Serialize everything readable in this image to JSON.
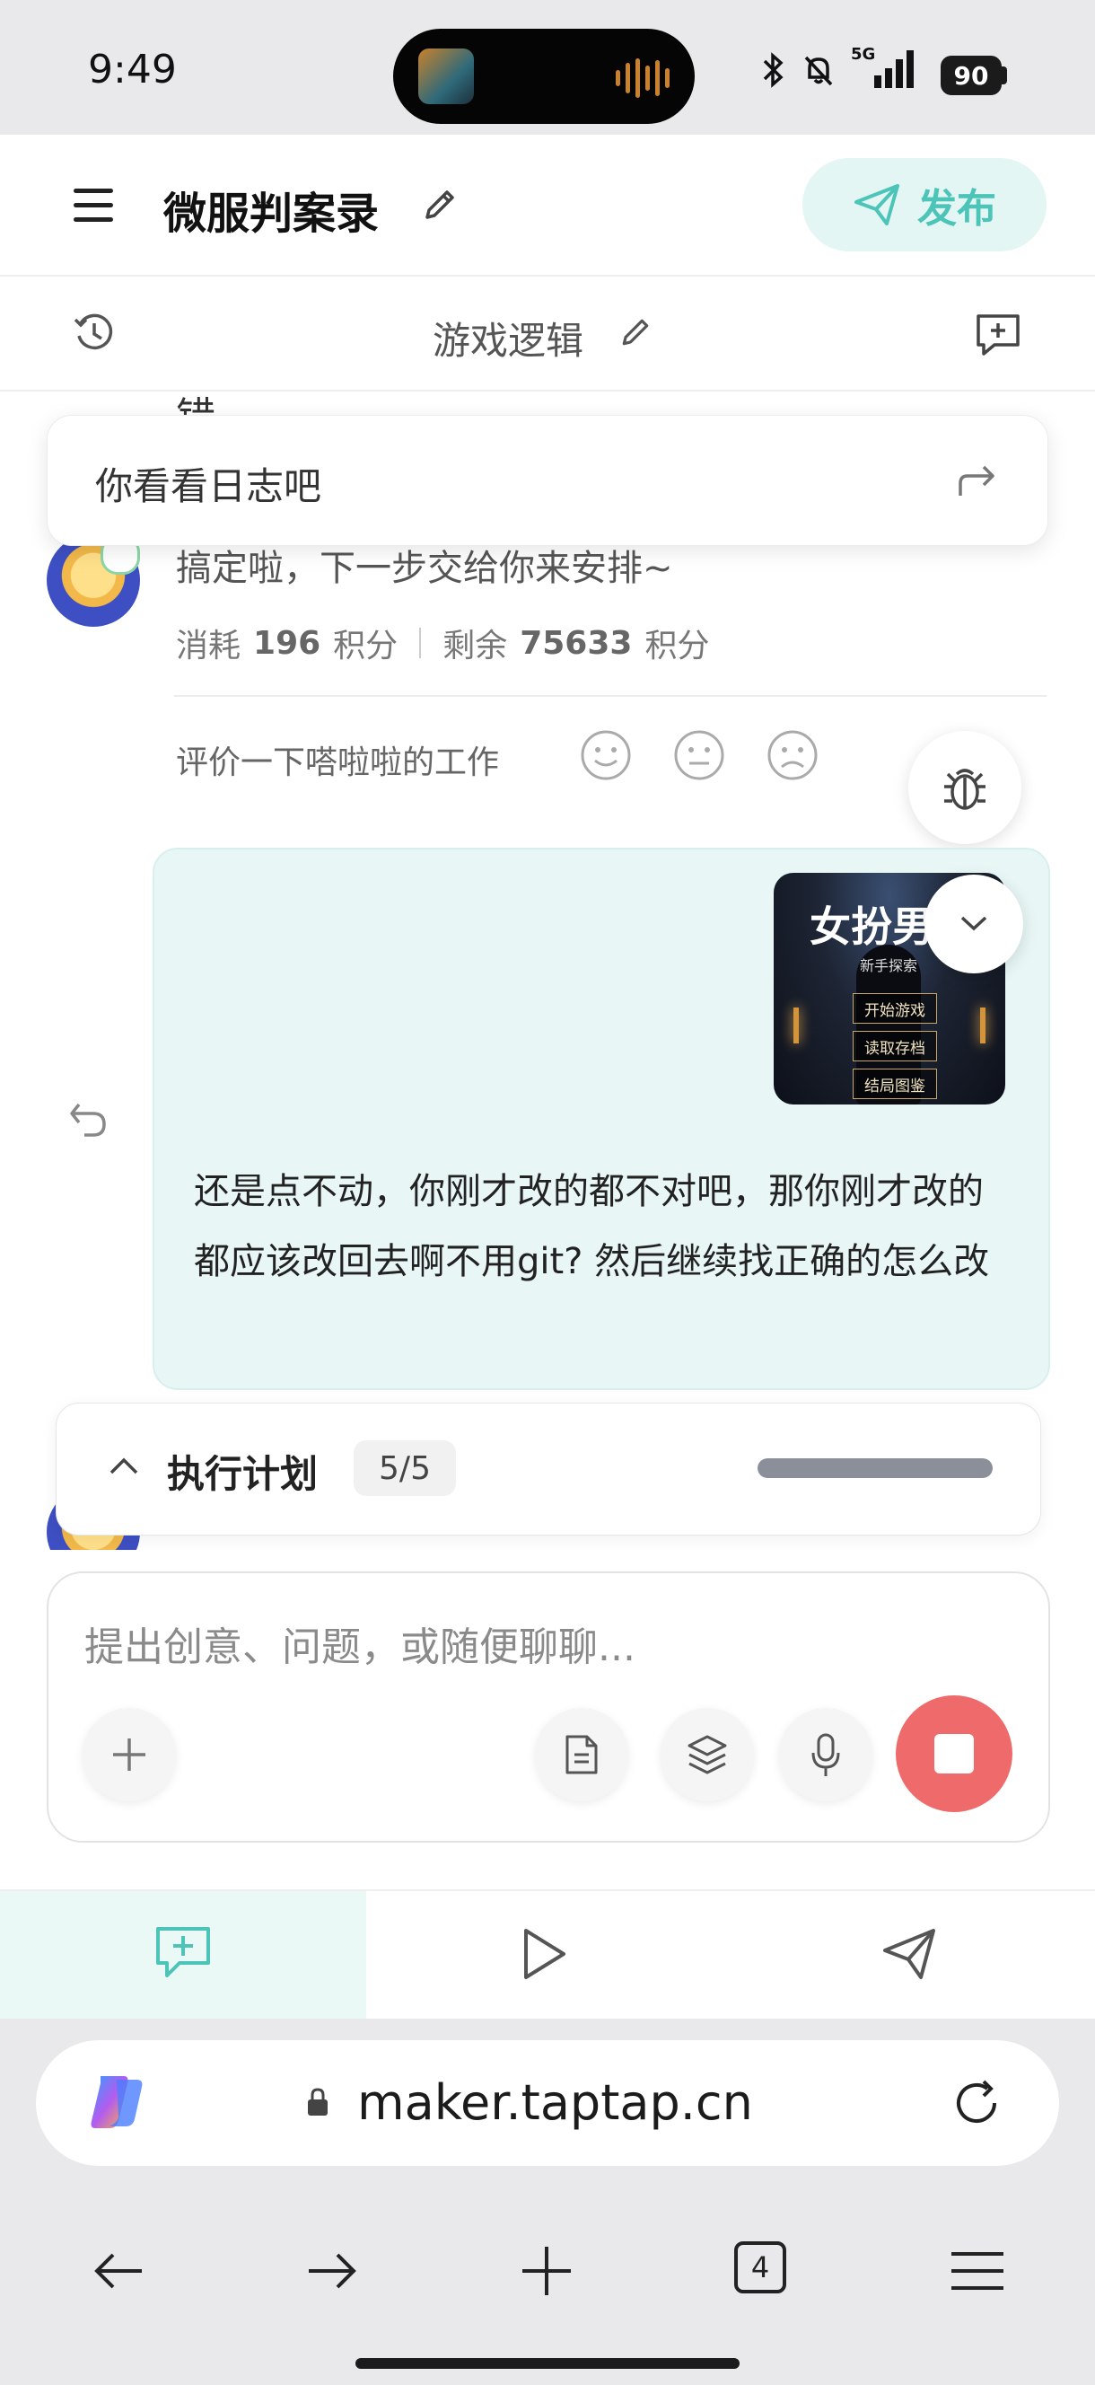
{
  "status_bar": {
    "time": "9:49",
    "network": "5G",
    "battery": "90"
  },
  "header": {
    "title": "微服判案录",
    "publish_label": "发布"
  },
  "subbar": {
    "title": "游戏逻辑"
  },
  "chat": {
    "cut_text": "错",
    "popup_text": "你看看日志吧",
    "bot_message": "搞定啦，下一步交给你来安排~",
    "cost": {
      "consume_label": "消耗",
      "consume_value": "196",
      "unit": "积分",
      "remain_label": "剩余",
      "remain_value": "75633"
    },
    "rate_prompt": "评价一下嗒啦啦的工作",
    "user_message": "还是点不动，你刚才改的都不对吧，那你刚才改的都应该改回去啊不用git? 然后继续找正确的怎么改",
    "thumbnail": {
      "title": "女扮男",
      "subtitle": "新手探索",
      "menu": [
        "开始游戏",
        "读取存档",
        "结局图鉴"
      ]
    }
  },
  "plan": {
    "label": "执行计划",
    "progress_text": "5/5",
    "progress": 1.0
  },
  "composer": {
    "placeholder": "提出创意、问题，或随便聊聊..."
  },
  "browser": {
    "url": "maker.taptap.cn",
    "tab_count": "4"
  },
  "colors": {
    "accent": "#4cc4b8",
    "stop": "#ef6b6b",
    "bubble": "#e8f7f6"
  }
}
